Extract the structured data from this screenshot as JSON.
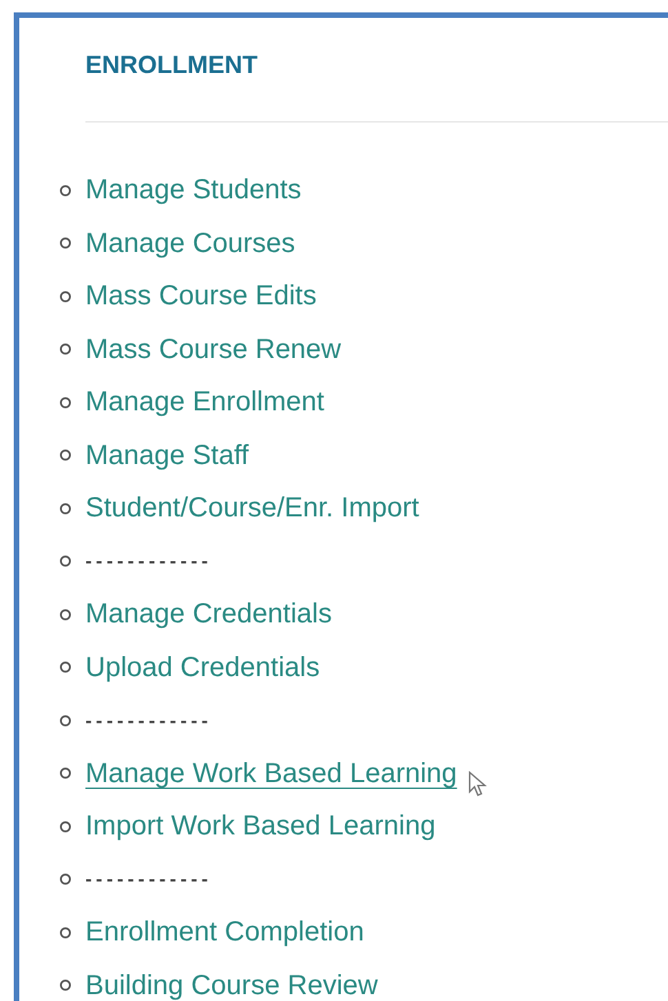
{
  "section": {
    "title": "ENROLLMENT"
  },
  "items": [
    {
      "kind": "link",
      "label": "Manage Students",
      "hovered": false
    },
    {
      "kind": "link",
      "label": "Manage Courses",
      "hovered": false
    },
    {
      "kind": "link",
      "label": "Mass Course Edits",
      "hovered": false
    },
    {
      "kind": "link",
      "label": "Mass Course Renew",
      "hovered": false
    },
    {
      "kind": "link",
      "label": "Manage Enrollment",
      "hovered": false
    },
    {
      "kind": "link",
      "label": "Manage Staff",
      "hovered": false
    },
    {
      "kind": "link",
      "label": "Student/Course/Enr. Import",
      "hovered": false
    },
    {
      "kind": "separator",
      "label": "------------"
    },
    {
      "kind": "link",
      "label": "Manage Credentials",
      "hovered": false
    },
    {
      "kind": "link",
      "label": "Upload Credentials",
      "hovered": false
    },
    {
      "kind": "separator",
      "label": "------------"
    },
    {
      "kind": "link",
      "label": "Manage Work Based Learning",
      "hovered": true
    },
    {
      "kind": "link",
      "label": "Import Work Based Learning",
      "hovered": false
    },
    {
      "kind": "separator",
      "label": "------------"
    },
    {
      "kind": "link",
      "label": "Enrollment Completion",
      "hovered": false
    },
    {
      "kind": "link",
      "label": "Building Course Review",
      "hovered": false
    }
  ]
}
